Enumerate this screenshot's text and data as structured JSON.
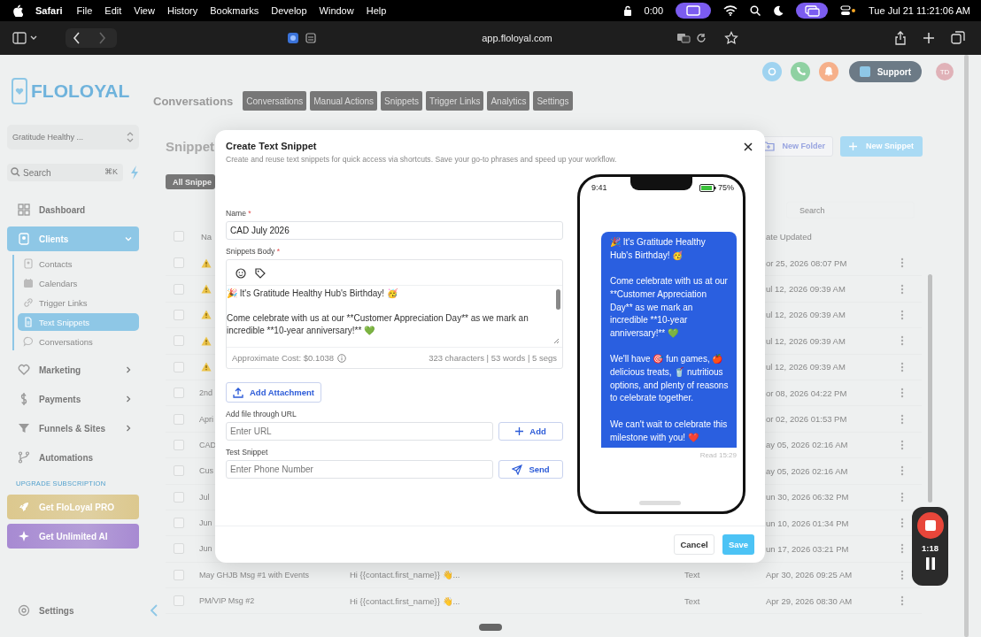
{
  "menu_bar": {
    "app": "Safari",
    "menus": [
      "File",
      "Edit",
      "View",
      "History",
      "Bookmarks",
      "Develop",
      "Window",
      "Help"
    ],
    "timer": "0:00",
    "datetime": "Tue Jul 21  11:21:06 AM"
  },
  "browser": {
    "url": "app.floloyal.com"
  },
  "app_header": {
    "logo": "FLOLOYAL",
    "support": "Support",
    "avatar": "TD",
    "section_title": "Conversations",
    "tabs": [
      {
        "label": "Conversations",
        "selected": false
      },
      {
        "label": "Manual Actions",
        "selected": false
      },
      {
        "label": "Snippets",
        "selected": false
      },
      {
        "label": "Trigger Links",
        "selected": false
      },
      {
        "label": "Analytics",
        "selected": false
      },
      {
        "label": "Settings",
        "selected": false
      }
    ]
  },
  "sidebar": {
    "account": "Gratitude Healthy ...",
    "search_placeholder": "Search",
    "shortcut": "⌘K",
    "items": [
      {
        "label": "Dashboard",
        "kind": "link",
        "selected": false
      },
      {
        "label": "Clients",
        "kind": "group",
        "selected": true,
        "expanded": true,
        "children": [
          {
            "label": "Contacts",
            "selected": false
          },
          {
            "label": "Calendars",
            "selected": false
          },
          {
            "label": "Trigger Links",
            "selected": false
          },
          {
            "label": "Text Snippets",
            "selected": true
          },
          {
            "label": "Conversations",
            "selected": false
          }
        ]
      },
      {
        "label": "Marketing",
        "kind": "group",
        "selected": false,
        "expanded": false
      },
      {
        "label": "Payments",
        "kind": "group",
        "selected": false,
        "expanded": false
      },
      {
        "label": "Funnels & Sites",
        "kind": "group",
        "selected": false,
        "expanded": false
      },
      {
        "label": "Automations",
        "kind": "link",
        "selected": false
      }
    ],
    "upgrade_heading": "UPGRADE SUBSCRIPTION",
    "promos": [
      {
        "label": "Get FloLoyal PRO",
        "color": "#dcc88e"
      },
      {
        "label": "Get Unlimited AI",
        "color": "#a78ad2"
      }
    ],
    "settings": "Settings"
  },
  "page": {
    "title": "Snippet",
    "filter": "All Snippe",
    "new_folder": "New Folder",
    "new_snippet": "New Snippet",
    "search_placeholder": "Search",
    "table": {
      "columns": [
        "Na",
        "ate Updated"
      ],
      "header_checked": false,
      "rows": [
        {
          "checked": false,
          "warning": true,
          "date": "or 25, 2026 08:07 PM"
        },
        {
          "checked": false,
          "warning": true,
          "date": "ul 12, 2026 09:39 AM"
        },
        {
          "checked": false,
          "warning": true,
          "date": "ul 12, 2026 09:39 AM"
        },
        {
          "checked": false,
          "warning": true,
          "date": "ul 12, 2026 09:39 AM"
        },
        {
          "checked": false,
          "warning": true,
          "date": "ul 12, 2026 09:39 AM"
        },
        {
          "checked": false,
          "warning": false,
          "name": "2nd",
          "date": "or 08, 2026 04:22 PM"
        },
        {
          "checked": false,
          "warning": false,
          "name": "Apri",
          "date": "or 02, 2026 01:53 PM"
        },
        {
          "checked": false,
          "warning": false,
          "name": "CAD",
          "date": "ay 05, 2026 02:16 AM"
        },
        {
          "checked": false,
          "warning": false,
          "name": "Cus",
          "date": "ay 05, 2026 02:16 AM"
        },
        {
          "checked": false,
          "warning": false,
          "name": "Jul",
          "date": "un 30, 2026 06:32 PM"
        },
        {
          "checked": false,
          "warning": false,
          "name": "Jun",
          "date": "un 10, 2026 01:34 PM"
        },
        {
          "checked": false,
          "warning": false,
          "name": "Jun",
          "date": "un 17, 2026 03:21 PM"
        },
        {
          "checked": false,
          "warning": false,
          "name": "May GHJB Msg #1 with Events",
          "content": "Hi {{contact.first_name}} 👋...",
          "type": "Text",
          "date": "Apr 30, 2026 09:25 AM"
        },
        {
          "checked": false,
          "warning": false,
          "name": "PM/VIP Msg #2",
          "content": "Hi {{contact.first_name}} 👋...",
          "type": "Text",
          "date": "Apr 29, 2026 08:30 AM"
        }
      ]
    }
  },
  "modal": {
    "title": "Create Text Snippet",
    "subtitle": "Create and reuse text snippets for quick access via shortcuts. Save your go-to phrases and speed up your workflow.",
    "name_label": {
      "text": "Name",
      "mark": "*"
    },
    "name_value": "CAD July 2026",
    "body_label": {
      "text": "Snippets Body",
      "mark": "*"
    },
    "body": "🎉 It's Gratitude Healthy Hub's Birthday! 🥳\n\nCome celebrate with us at our **Customer Appreciation Day** as we mark an incredible **10-year anniversary!** 💚",
    "cost": "Approximate Cost: $0.1038",
    "counts": "323 characters | 53 words | 5 segs",
    "attach": "Add Attachment",
    "url_label": "Add file through URL",
    "url_placeholder": "Enter URL",
    "add": "Add",
    "test_label": "Test Snippet",
    "phone_placeholder": "Enter Phone Number",
    "send": "Send",
    "cancel": "Cancel",
    "save": "Save"
  },
  "phone": {
    "time": "9:41",
    "battery": "75%",
    "message": "🎉 It's Gratitude Healthy Hub's Birthday! 🥳\n\nCome celebrate with us at our **Customer Appreciation Day** as we mark an incredible **10-year anniversary!** 💚\n\nWe'll have 🎯 fun games, 🍎 delicious treats, 🥤 nutritious options, and plenty of reasons to celebrate together.\n\nWe can't wait to celebrate this milestone with you! ❤️",
    "receipt": "Read 15:29"
  },
  "recorder": {
    "elapsed": "1:18"
  }
}
